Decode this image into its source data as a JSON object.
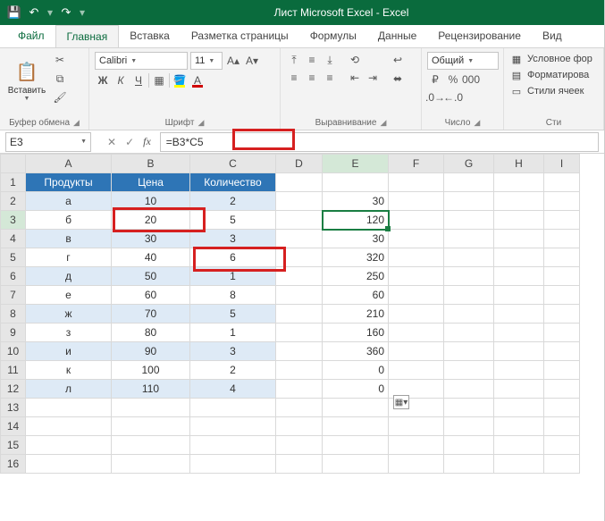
{
  "window": {
    "title": "Лист Microsoft Excel - Excel"
  },
  "qat": {
    "save": "💾",
    "undo": "↶",
    "redo": "↷"
  },
  "tabs": {
    "file": "Файл",
    "items": [
      "Главная",
      "Вставка",
      "Разметка страницы",
      "Формулы",
      "Данные",
      "Рецензирование",
      "Вид"
    ],
    "active": 0
  },
  "ribbon": {
    "clipboard": {
      "label": "Буфер обмена",
      "paste": "Вставить"
    },
    "font": {
      "label": "Шрифт",
      "name": "Calibri",
      "size": "11",
      "bold": "Ж",
      "italic": "К",
      "underline": "Ч"
    },
    "align": {
      "label": "Выравнивание"
    },
    "number": {
      "label": "Число",
      "format": "Общий"
    },
    "styles": {
      "label": "Сти",
      "cond": "Условное фор",
      "fmt": "Форматирова",
      "cell": "Стили ячеек"
    }
  },
  "fbar": {
    "cellref": "E3",
    "formula": "=B3*C5"
  },
  "columns": [
    "A",
    "B",
    "C",
    "D",
    "E",
    "F",
    "G",
    "H",
    "I"
  ],
  "header_row": {
    "A": "Продукты",
    "B": "Цена",
    "C": "Количество"
  },
  "rows": [
    {
      "A": "а",
      "B": "10",
      "C": "2",
      "E": "30"
    },
    {
      "A": "б",
      "B": "20",
      "C": "5",
      "E": "120"
    },
    {
      "A": "в",
      "B": "30",
      "C": "3",
      "E": "30"
    },
    {
      "A": "г",
      "B": "40",
      "C": "6",
      "E": "320"
    },
    {
      "A": "д",
      "B": "50",
      "C": "1",
      "E": "250"
    },
    {
      "A": "е",
      "B": "60",
      "C": "8",
      "E": "60"
    },
    {
      "A": "ж",
      "B": "70",
      "C": "5",
      "E": "210"
    },
    {
      "A": "з",
      "B": "80",
      "C": "1",
      "E": "160"
    },
    {
      "A": "и",
      "B": "90",
      "C": "3",
      "E": "360"
    },
    {
      "A": "к",
      "B": "100",
      "C": "2",
      "E": "0"
    },
    {
      "A": "л",
      "B": "110",
      "C": "4",
      "E": "0"
    }
  ],
  "extra_rows": [
    13,
    14,
    15,
    16
  ],
  "selected": {
    "row": 3,
    "col": "E"
  }
}
